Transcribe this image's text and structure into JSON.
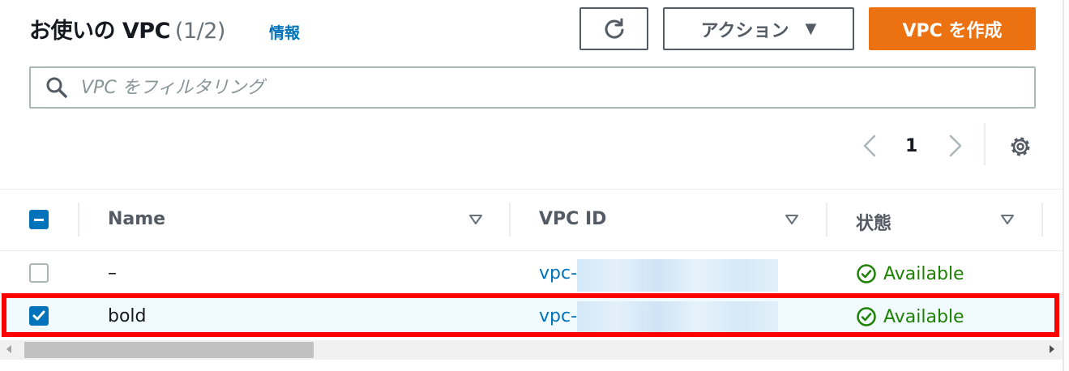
{
  "header": {
    "title": "お使いの VPC",
    "count": "(1/2)",
    "info_link": "情報",
    "action_button": "アクション",
    "create_button": "VPC を作成"
  },
  "search": {
    "placeholder": "VPC をフィルタリング",
    "value": ""
  },
  "pagination": {
    "current_page": "1"
  },
  "table": {
    "columns": [
      "Name",
      "VPC ID",
      "状態"
    ],
    "rows": [
      {
        "name": "–",
        "vpc_id": "vpc-",
        "status": "Available",
        "selected": false
      },
      {
        "name": "bold",
        "vpc_id": "vpc-",
        "status": "Available",
        "selected": true
      }
    ],
    "header_checkbox_state": "indeterminate"
  },
  "colors": {
    "accent": "#0073bb",
    "primary_button": "#ec7211",
    "success": "#1d8102",
    "highlight": "#ff0000"
  },
  "icons": {
    "refresh": "refresh-icon",
    "dropdown": "caret-down-icon",
    "search": "search-icon",
    "prev": "chevron-left-icon",
    "next": "chevron-right-icon",
    "settings": "gear-icon",
    "sort": "sort-down-icon",
    "status": "check-circle-icon"
  }
}
